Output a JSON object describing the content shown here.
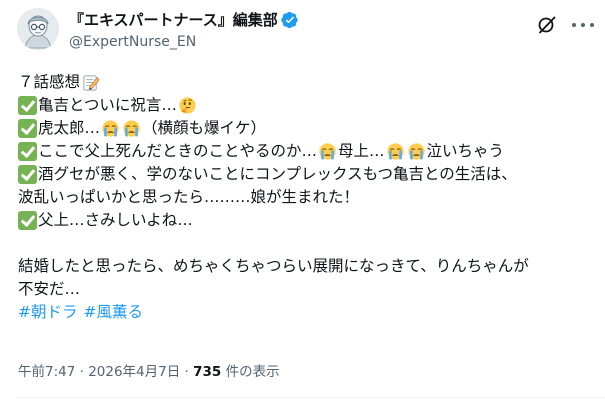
{
  "author": {
    "display_name": "『エキスパートナース』編集部",
    "handle": "@ExpertNurse_EN",
    "verified_color": "#1d9bf0"
  },
  "icons": {
    "avatar": "avatar-illustration",
    "verified": "verified-badge-icon",
    "grok": "grok-icon",
    "more": "more-options-icon"
  },
  "tweet": {
    "lines": [
      "７話感想",
      "亀吉とついに祝言…",
      "虎太郎…",
      "（横顔も爆イケ）",
      "ここで父上死んだときのことやるのか…",
      "母上…",
      "泣いちゃう",
      "酒グセが悪く、学のないことにコンプレックスもつ亀吉との生活は、",
      "波乱いっぱいかと思ったら………娘が生まれた！",
      "父上…さみしいよね…",
      "結婚したと思ったら、めちゃくちゃつらい展開になっきて、りんちゃんが",
      "不安だ…"
    ],
    "hashtags": [
      "#朝ドラ",
      "#風薫る"
    ]
  },
  "meta": {
    "time": "午前7:47",
    "separator": " · ",
    "date": "2026年4月7日",
    "views_count": "735",
    "views_label": " 件の表示"
  }
}
